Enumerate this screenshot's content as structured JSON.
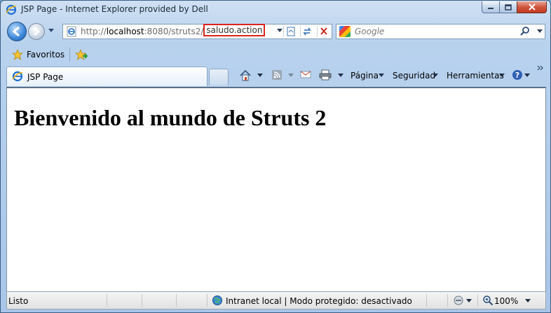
{
  "window": {
    "title": "JSP Page - Internet Explorer provided by Dell"
  },
  "address_bar": {
    "url_prefix": "http://",
    "url_host": "localhost",
    "url_path": ":8080/struts2/",
    "url_highlight": "saludo.action",
    "highlight_color": "#d9241c"
  },
  "search": {
    "placeholder": "Google"
  },
  "favorites_bar": {
    "favorites_label": "Favoritos"
  },
  "tab": {
    "label": "JSP Page"
  },
  "command_bar": {
    "page_label": "Página",
    "security_label": "Seguridad",
    "tools_label": "Herramientas"
  },
  "content": {
    "heading": "Bienvenido al mundo de Struts 2"
  },
  "status_bar": {
    "status": "Listo",
    "zone": "Intranet local | Modo protegido: desactivado",
    "zoom": "100%"
  }
}
